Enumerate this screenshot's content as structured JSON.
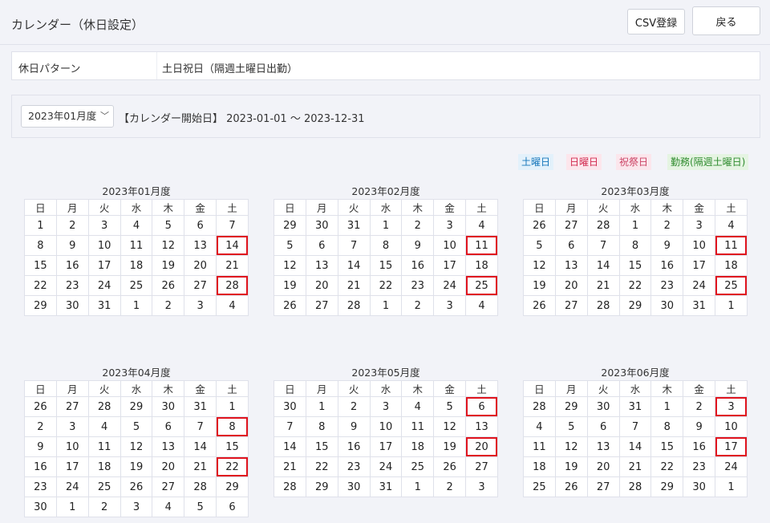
{
  "header": {
    "title": "カレンダー（休日設定）",
    "csv_button": "CSV登録",
    "back_button": "戻る"
  },
  "pattern": {
    "label": "休日パターン",
    "value": "土日祝日（隔週土曜日出勤）"
  },
  "period": {
    "selected": "2023年01月度",
    "text": "【カレンダー開始日】 2023-01-01 〜 2023-12-31"
  },
  "legend": {
    "saturday": "土曜日",
    "sunday": "日曜日",
    "holiday": "祝祭日",
    "work": "勤務(隔週土曜日)"
  },
  "weekdays": [
    "日",
    "月",
    "火",
    "水",
    "木",
    "金",
    "土"
  ],
  "months": [
    {
      "title": "2023年01月度",
      "weeks": [
        [
          {
            "d": "1",
            "t": "sun"
          },
          {
            "d": "2",
            "t": "hol"
          },
          {
            "d": "3",
            "t": "other"
          },
          {
            "d": "4",
            "t": "other"
          },
          {
            "d": "5",
            "t": "other"
          },
          {
            "d": "6",
            "t": "other"
          },
          {
            "d": "7",
            "t": "sat"
          }
        ],
        [
          {
            "d": "8",
            "t": "sun"
          },
          {
            "d": "9",
            "t": "hol"
          },
          {
            "d": "10",
            "t": "other"
          },
          {
            "d": "11",
            "t": "other"
          },
          {
            "d": "12",
            "t": "other"
          },
          {
            "d": "13",
            "t": "other"
          },
          {
            "d": "14",
            "t": "work"
          }
        ],
        [
          {
            "d": "15",
            "t": "sun"
          },
          {
            "d": "16",
            "t": "other"
          },
          {
            "d": "17",
            "t": "other"
          },
          {
            "d": "18",
            "t": "other"
          },
          {
            "d": "19",
            "t": "other"
          },
          {
            "d": "20",
            "t": "other"
          },
          {
            "d": "21",
            "t": "sat"
          }
        ],
        [
          {
            "d": "22",
            "t": "sun"
          },
          {
            "d": "23",
            "t": "other"
          },
          {
            "d": "24",
            "t": "other"
          },
          {
            "d": "25",
            "t": "other"
          },
          {
            "d": "26",
            "t": "other"
          },
          {
            "d": "27",
            "t": "other"
          },
          {
            "d": "28",
            "t": "work"
          }
        ],
        [
          {
            "d": "29",
            "t": "sun"
          },
          {
            "d": "30",
            "t": "other"
          },
          {
            "d": "31",
            "t": "other"
          },
          {
            "d": "1",
            "t": ""
          },
          {
            "d": "2",
            "t": ""
          },
          {
            "d": "3",
            "t": ""
          },
          {
            "d": "4",
            "t": ""
          }
        ]
      ]
    },
    {
      "title": "2023年02月度",
      "weeks": [
        [
          {
            "d": "29",
            "t": ""
          },
          {
            "d": "30",
            "t": ""
          },
          {
            "d": "31",
            "t": ""
          },
          {
            "d": "1",
            "t": "other"
          },
          {
            "d": "2",
            "t": "other"
          },
          {
            "d": "3",
            "t": "other"
          },
          {
            "d": "4",
            "t": "sat"
          }
        ],
        [
          {
            "d": "5",
            "t": "sun"
          },
          {
            "d": "6",
            "t": "other"
          },
          {
            "d": "7",
            "t": "other"
          },
          {
            "d": "8",
            "t": "other"
          },
          {
            "d": "9",
            "t": "other"
          },
          {
            "d": "10",
            "t": "other"
          },
          {
            "d": "11",
            "t": "work"
          }
        ],
        [
          {
            "d": "12",
            "t": "sun"
          },
          {
            "d": "13",
            "t": "other"
          },
          {
            "d": "14",
            "t": "other"
          },
          {
            "d": "15",
            "t": "other"
          },
          {
            "d": "16",
            "t": "other"
          },
          {
            "d": "17",
            "t": "other"
          },
          {
            "d": "18",
            "t": "sat"
          }
        ],
        [
          {
            "d": "19",
            "t": "sun"
          },
          {
            "d": "20",
            "t": "other"
          },
          {
            "d": "21",
            "t": "other"
          },
          {
            "d": "22",
            "t": "other"
          },
          {
            "d": "23",
            "t": "hol"
          },
          {
            "d": "24",
            "t": "other"
          },
          {
            "d": "25",
            "t": "work"
          }
        ],
        [
          {
            "d": "26",
            "t": "sun"
          },
          {
            "d": "27",
            "t": "other"
          },
          {
            "d": "28",
            "t": "other"
          },
          {
            "d": "1",
            "t": ""
          },
          {
            "d": "2",
            "t": ""
          },
          {
            "d": "3",
            "t": ""
          },
          {
            "d": "4",
            "t": ""
          }
        ]
      ]
    },
    {
      "title": "2023年03月度",
      "weeks": [
        [
          {
            "d": "26",
            "t": ""
          },
          {
            "d": "27",
            "t": ""
          },
          {
            "d": "28",
            "t": ""
          },
          {
            "d": "1",
            "t": "other"
          },
          {
            "d": "2",
            "t": "other"
          },
          {
            "d": "3",
            "t": "other"
          },
          {
            "d": "4",
            "t": "sat"
          }
        ],
        [
          {
            "d": "5",
            "t": "sun"
          },
          {
            "d": "6",
            "t": "other"
          },
          {
            "d": "7",
            "t": "other"
          },
          {
            "d": "8",
            "t": "other"
          },
          {
            "d": "9",
            "t": "other"
          },
          {
            "d": "10",
            "t": "other"
          },
          {
            "d": "11",
            "t": "work"
          }
        ],
        [
          {
            "d": "12",
            "t": "sun"
          },
          {
            "d": "13",
            "t": "other"
          },
          {
            "d": "14",
            "t": "other"
          },
          {
            "d": "15",
            "t": "other"
          },
          {
            "d": "16",
            "t": "other"
          },
          {
            "d": "17",
            "t": "other"
          },
          {
            "d": "18",
            "t": "sat"
          }
        ],
        [
          {
            "d": "19",
            "t": "sun"
          },
          {
            "d": "20",
            "t": "other"
          },
          {
            "d": "21",
            "t": "hol"
          },
          {
            "d": "22",
            "t": "other"
          },
          {
            "d": "23",
            "t": "other"
          },
          {
            "d": "24",
            "t": "other"
          },
          {
            "d": "25",
            "t": "work"
          }
        ],
        [
          {
            "d": "26",
            "t": "sun"
          },
          {
            "d": "27",
            "t": "other"
          },
          {
            "d": "28",
            "t": "other"
          },
          {
            "d": "29",
            "t": "other"
          },
          {
            "d": "30",
            "t": "other"
          },
          {
            "d": "31",
            "t": "other"
          },
          {
            "d": "1",
            "t": ""
          }
        ]
      ]
    },
    {
      "title": "2023年04月度",
      "weeks": [
        [
          {
            "d": "26",
            "t": ""
          },
          {
            "d": "27",
            "t": ""
          },
          {
            "d": "28",
            "t": ""
          },
          {
            "d": "29",
            "t": ""
          },
          {
            "d": "30",
            "t": ""
          },
          {
            "d": "31",
            "t": ""
          },
          {
            "d": "1",
            "t": "sat"
          }
        ],
        [
          {
            "d": "2",
            "t": "sun"
          },
          {
            "d": "3",
            "t": "other"
          },
          {
            "d": "4",
            "t": "other"
          },
          {
            "d": "5",
            "t": "other"
          },
          {
            "d": "6",
            "t": "other"
          },
          {
            "d": "7",
            "t": "other"
          },
          {
            "d": "8",
            "t": "work"
          }
        ],
        [
          {
            "d": "9",
            "t": "sun"
          },
          {
            "d": "10",
            "t": "other"
          },
          {
            "d": "11",
            "t": "other"
          },
          {
            "d": "12",
            "t": "other"
          },
          {
            "d": "13",
            "t": "other"
          },
          {
            "d": "14",
            "t": "other"
          },
          {
            "d": "15",
            "t": "sat"
          }
        ],
        [
          {
            "d": "16",
            "t": "sun"
          },
          {
            "d": "17",
            "t": "other"
          },
          {
            "d": "18",
            "t": "other"
          },
          {
            "d": "19",
            "t": "other"
          },
          {
            "d": "20",
            "t": "other"
          },
          {
            "d": "21",
            "t": "other"
          },
          {
            "d": "22",
            "t": "work"
          }
        ],
        [
          {
            "d": "23",
            "t": "sun"
          },
          {
            "d": "24",
            "t": "other"
          },
          {
            "d": "25",
            "t": "other"
          },
          {
            "d": "26",
            "t": "other"
          },
          {
            "d": "27",
            "t": "other"
          },
          {
            "d": "28",
            "t": "other"
          },
          {
            "d": "29",
            "t": "hol"
          }
        ],
        [
          {
            "d": "30",
            "t": "sun"
          },
          {
            "d": "1",
            "t": ""
          },
          {
            "d": "2",
            "t": ""
          },
          {
            "d": "3",
            "t": ""
          },
          {
            "d": "4",
            "t": ""
          },
          {
            "d": "5",
            "t": ""
          },
          {
            "d": "6",
            "t": ""
          }
        ]
      ]
    },
    {
      "title": "2023年05月度",
      "weeks": [
        [
          {
            "d": "30",
            "t": ""
          },
          {
            "d": "1",
            "t": "other"
          },
          {
            "d": "2",
            "t": "other"
          },
          {
            "d": "3",
            "t": "hol"
          },
          {
            "d": "4",
            "t": "hol"
          },
          {
            "d": "5",
            "t": "hol"
          },
          {
            "d": "6",
            "t": "work"
          }
        ],
        [
          {
            "d": "7",
            "t": "sun"
          },
          {
            "d": "8",
            "t": "other"
          },
          {
            "d": "9",
            "t": "other"
          },
          {
            "d": "10",
            "t": "other"
          },
          {
            "d": "11",
            "t": "other"
          },
          {
            "d": "12",
            "t": "other"
          },
          {
            "d": "13",
            "t": "sat"
          }
        ],
        [
          {
            "d": "14",
            "t": "sun"
          },
          {
            "d": "15",
            "t": "other"
          },
          {
            "d": "16",
            "t": "other"
          },
          {
            "d": "17",
            "t": "other"
          },
          {
            "d": "18",
            "t": "other"
          },
          {
            "d": "19",
            "t": "other"
          },
          {
            "d": "20",
            "t": "work"
          }
        ],
        [
          {
            "d": "21",
            "t": "sun"
          },
          {
            "d": "22",
            "t": "other"
          },
          {
            "d": "23",
            "t": "other"
          },
          {
            "d": "24",
            "t": "other"
          },
          {
            "d": "25",
            "t": "other"
          },
          {
            "d": "26",
            "t": "other"
          },
          {
            "d": "27",
            "t": "sat"
          }
        ],
        [
          {
            "d": "28",
            "t": "sun"
          },
          {
            "d": "29",
            "t": "other"
          },
          {
            "d": "30",
            "t": "other"
          },
          {
            "d": "31",
            "t": "other"
          },
          {
            "d": "1",
            "t": ""
          },
          {
            "d": "2",
            "t": ""
          },
          {
            "d": "3",
            "t": ""
          }
        ]
      ]
    },
    {
      "title": "2023年06月度",
      "weeks": [
        [
          {
            "d": "28",
            "t": ""
          },
          {
            "d": "29",
            "t": ""
          },
          {
            "d": "30",
            "t": ""
          },
          {
            "d": "31",
            "t": ""
          },
          {
            "d": "1",
            "t": "other"
          },
          {
            "d": "2",
            "t": "other"
          },
          {
            "d": "3",
            "t": "work"
          }
        ],
        [
          {
            "d": "4",
            "t": "sun"
          },
          {
            "d": "5",
            "t": "other"
          },
          {
            "d": "6",
            "t": "other"
          },
          {
            "d": "7",
            "t": "other"
          },
          {
            "d": "8",
            "t": "other"
          },
          {
            "d": "9",
            "t": "other"
          },
          {
            "d": "10",
            "t": "sat"
          }
        ],
        [
          {
            "d": "11",
            "t": "sun"
          },
          {
            "d": "12",
            "t": "other"
          },
          {
            "d": "13",
            "t": "other"
          },
          {
            "d": "14",
            "t": "other"
          },
          {
            "d": "15",
            "t": "other"
          },
          {
            "d": "16",
            "t": "other"
          },
          {
            "d": "17",
            "t": "work"
          }
        ],
        [
          {
            "d": "18",
            "t": "sun"
          },
          {
            "d": "19",
            "t": "other"
          },
          {
            "d": "20",
            "t": "other"
          },
          {
            "d": "21",
            "t": "other"
          },
          {
            "d": "22",
            "t": "other"
          },
          {
            "d": "23",
            "t": "other"
          },
          {
            "d": "24",
            "t": "sat"
          }
        ],
        [
          {
            "d": "25",
            "t": "sun"
          },
          {
            "d": "26",
            "t": "other"
          },
          {
            "d": "27",
            "t": "other"
          },
          {
            "d": "28",
            "t": "other"
          },
          {
            "d": "29",
            "t": "other"
          },
          {
            "d": "30",
            "t": "other"
          },
          {
            "d": "1",
            "t": ""
          }
        ]
      ]
    }
  ]
}
